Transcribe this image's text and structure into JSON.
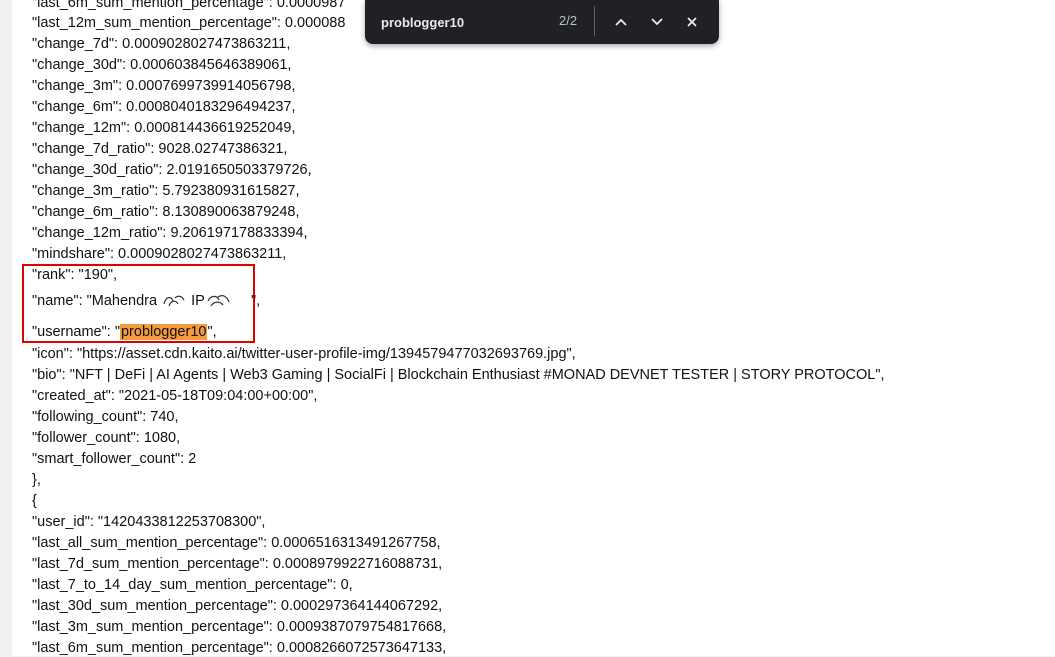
{
  "find_bar": {
    "query": "problogger10",
    "match_count": "2/2",
    "prev_label": "Previous match",
    "next_label": "Next match",
    "close_label": "Close find bar"
  },
  "highlight": {
    "match_text": "problogger10",
    "box_color": "#e00000",
    "match_color": "#f49b3e"
  },
  "lines": [
    "\"last_6m_sum_mention_percentage\": 0.0000987",
    "\"last_12m_sum_mention_percentage\": 0.000088",
    "\"change_7d\": 0.0009028027473863211,",
    "\"change_30d\": 0.000603845646389061,",
    "\"change_3m\": 0.0007699739914056798,",
    "\"change_6m\": 0.0008040183296494237,",
    "\"change_12m\": 0.000814436619252049,",
    "\"change_7d_ratio\": 9028.02747386321,",
    "\"change_30d_ratio\": 2.0191650503379726,",
    "\"change_3m_ratio\": 5.792380931615827,",
    "\"change_6m_ratio\": 8.130890063879248,",
    "\"change_12m_ratio\": 9.206197178833394,",
    "\"mindshare\": 0.0009028027473863211,",
    "\"rank\": \"190\",",
    "\"name\": \"Mahendra",
    "IP",
    "\",",
    "\"username\": \"",
    "\",",
    "\"icon\": \"https://asset.cdn.kaito.ai/twitter-user-profile-img/1394579477032693769.jpg\",",
    "\"bio\": \"NFT | DeFi | AI Agents | Web3 Gaming | SocialFi | Blockchain Enthusiast #MONAD DEVNET TESTER | STORY PROTOCOL\",",
    "\"created_at\": \"2021-05-18T09:04:00+00:00\",",
    "\"following_count\": 740,",
    "\"follower_count\": 1080,",
    "\"smart_follower_count\": 2",
    "},",
    "{",
    "\"user_id\": \"1420433812253708300\",",
    "\"last_all_sum_mention_percentage\": 0.0006516313491267758,",
    "\"last_7d_sum_mention_percentage\": 0.0008979922716088731,",
    "\"last_7_to_14_day_sum_mention_percentage\": 0,",
    "\"last_30d_sum_mention_percentage\": 0.000297364144067292,",
    "\"last_3m_sum_mention_percentage\": 0.0009387079754817668,",
    "\"last_6m_sum_mention_percentage\": 0.0008266072573647133,"
  ]
}
